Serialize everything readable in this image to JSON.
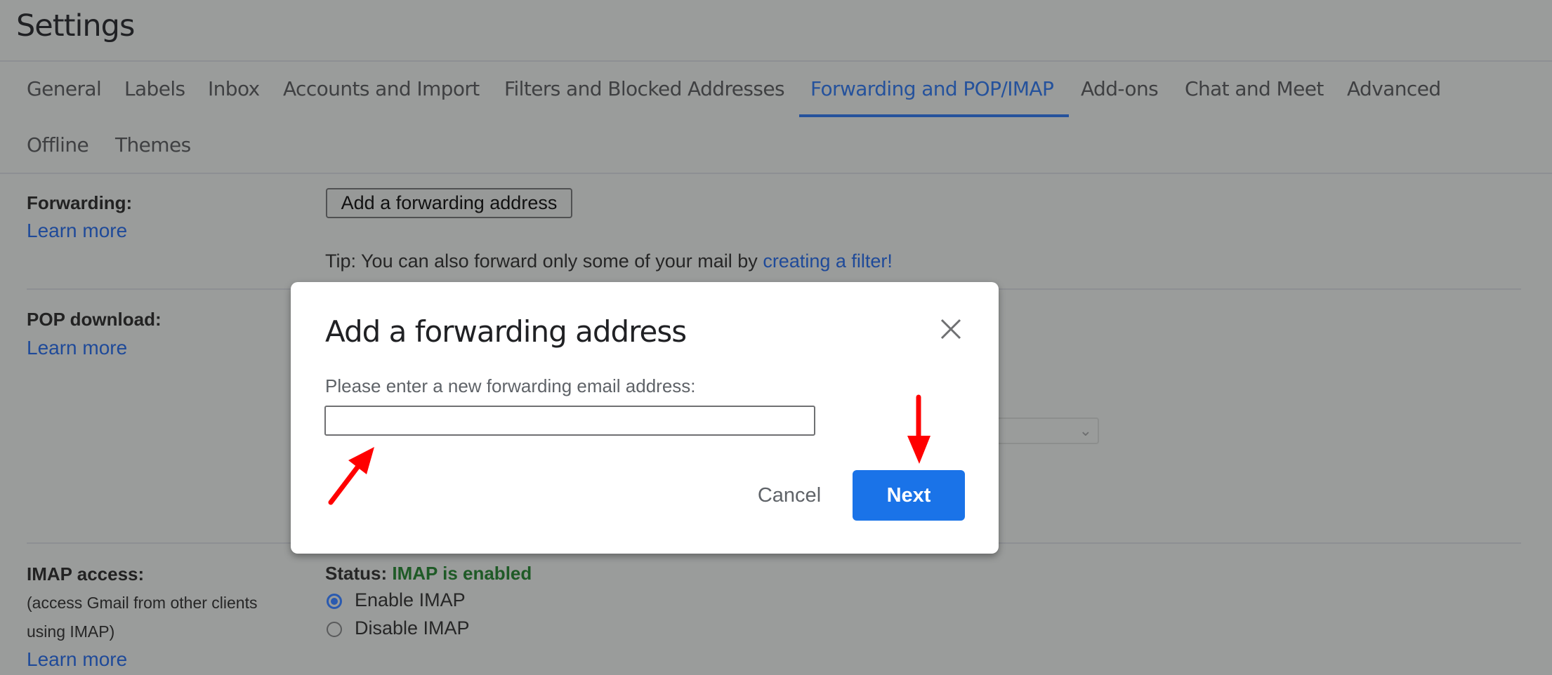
{
  "page": {
    "title": "Settings"
  },
  "tabs": [
    {
      "label": "General",
      "active": false
    },
    {
      "label": "Labels",
      "active": false
    },
    {
      "label": "Inbox",
      "active": false
    },
    {
      "label": "Accounts and Import",
      "active": false
    },
    {
      "label": "Filters and Blocked Addresses",
      "active": false
    },
    {
      "label": "Forwarding and POP/IMAP",
      "active": true
    },
    {
      "label": "Add-ons",
      "active": false
    },
    {
      "label": "Chat and Meet",
      "active": false
    },
    {
      "label": "Advanced",
      "active": false
    },
    {
      "label": "Offline",
      "active": false
    },
    {
      "label": "Themes",
      "active": false
    }
  ],
  "forwarding": {
    "label": "Forwarding:",
    "learn_more": "Learn more",
    "add_button": "Add a forwarding address",
    "tip_prefix": "Tip: You can also forward only some of your mail by ",
    "tip_link": "creating a filter!"
  },
  "pop": {
    "label": "POP download:",
    "learn_more": "Learn more"
  },
  "imap": {
    "label": "IMAP access:",
    "description_line1": "(access Gmail from other clients",
    "description_line2": "using IMAP)",
    "learn_more": "Learn more",
    "status_label": "Status: ",
    "status_value": "IMAP is enabled",
    "options": [
      {
        "label": "Enable IMAP",
        "checked": true
      },
      {
        "label": "Disable IMAP",
        "checked": false
      }
    ]
  },
  "dialog": {
    "title": "Add a forwarding address",
    "prompt": "Please enter a new forwarding email address:",
    "input_value": "",
    "cancel_label": "Cancel",
    "next_label": "Next",
    "close_icon": "close-icon"
  },
  "annotations": {
    "arrow_color": "#ff0000",
    "arrows": [
      "arrow-to-email-input",
      "arrow-to-next-button"
    ]
  },
  "colors": {
    "accent": "#1a73e8",
    "status_enabled": "#1e5a26",
    "link": "#1f4a99"
  }
}
